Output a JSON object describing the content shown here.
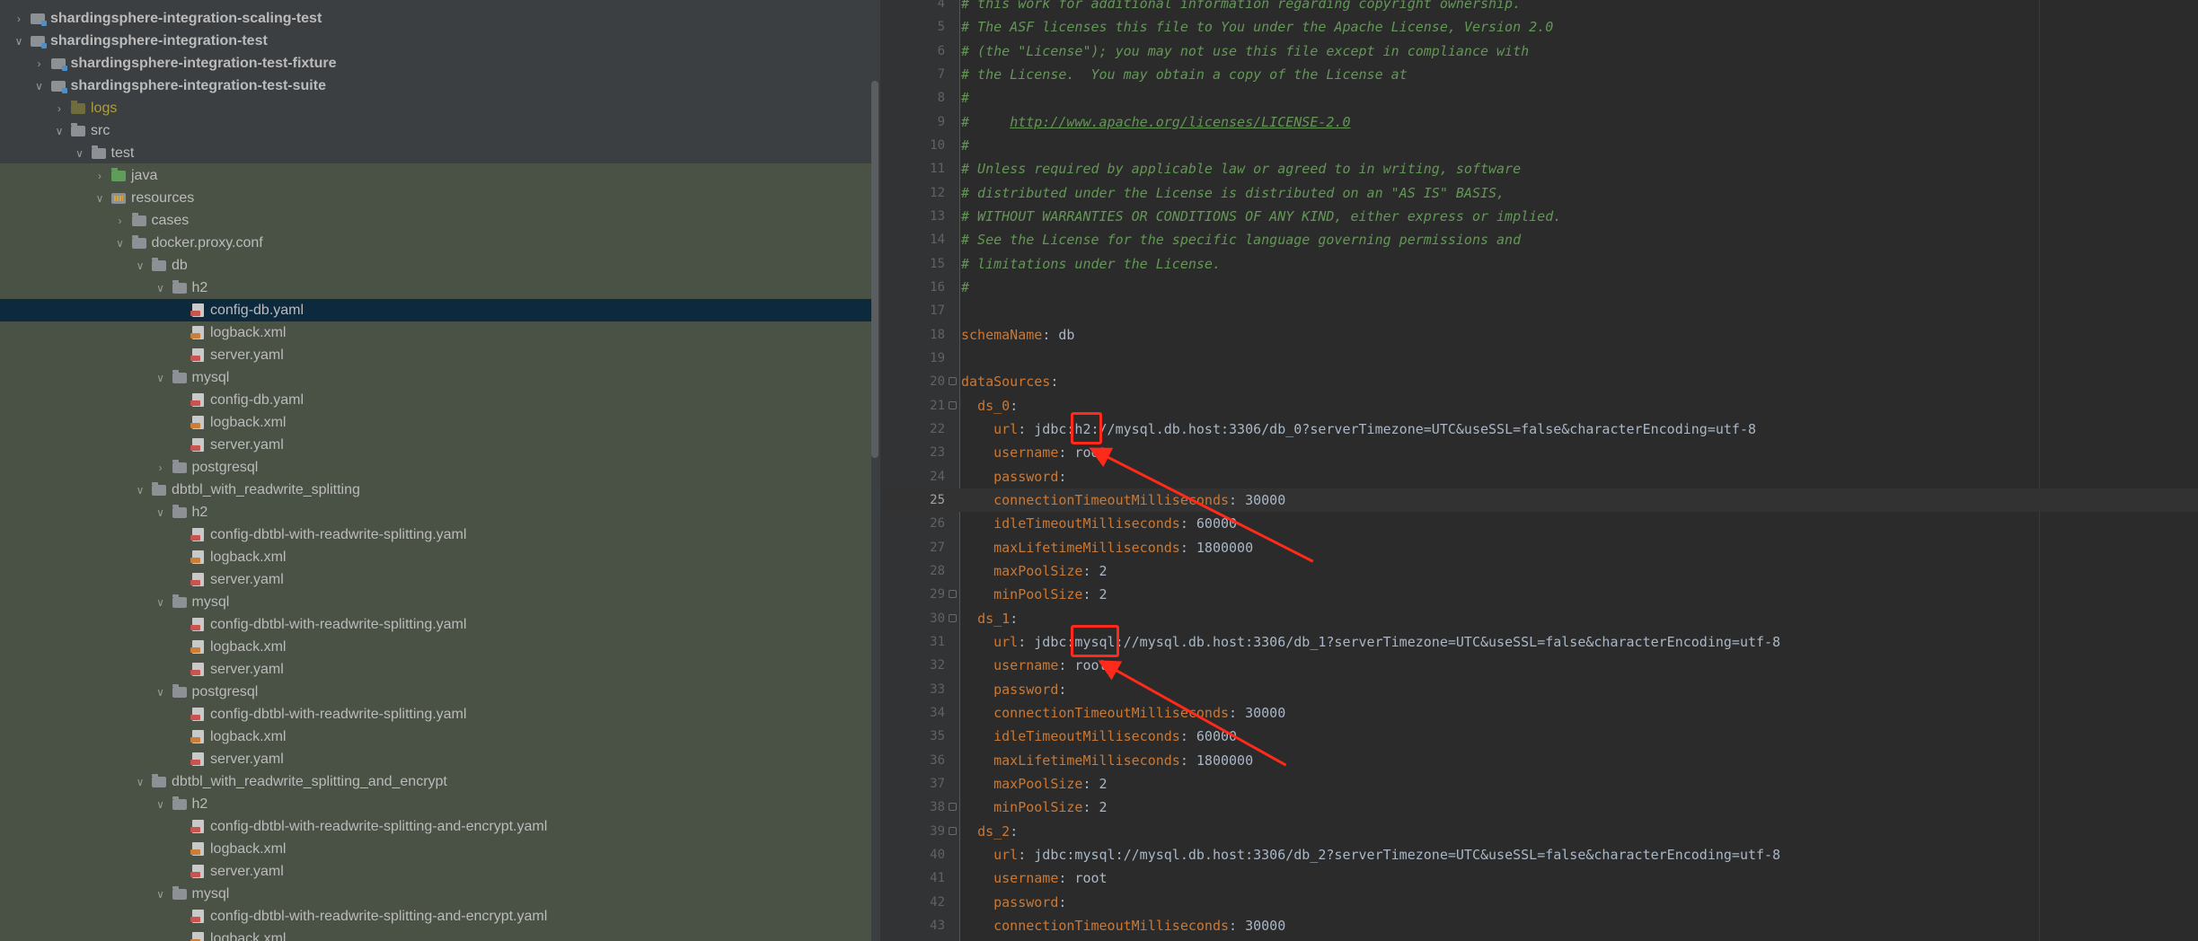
{
  "project_tree": {
    "rows": [
      {
        "label": "shardingsphere-integration-scaling-test",
        "depth": 1,
        "icon": "module",
        "expanded": false,
        "bold": true,
        "icon_name": "module-folder-icon"
      },
      {
        "label": "shardingsphere-integration-test",
        "depth": 1,
        "icon": "module",
        "expanded": true,
        "bold": true,
        "icon_name": "module-folder-icon"
      },
      {
        "label": "shardingsphere-integration-test-fixture",
        "depth": 2,
        "icon": "module",
        "expanded": false,
        "bold": true,
        "icon_name": "module-folder-icon"
      },
      {
        "label": "shardingsphere-integration-test-suite",
        "depth": 2,
        "icon": "module",
        "expanded": true,
        "bold": true,
        "icon_name": "module-folder-icon"
      },
      {
        "label": "logs",
        "depth": 3,
        "icon": "logs",
        "expanded": false,
        "excluded": true,
        "icon_name": "excluded-folder-icon"
      },
      {
        "label": "src",
        "depth": 3,
        "icon": "folder",
        "expanded": true,
        "icon_name": "folder-icon"
      },
      {
        "label": "test",
        "depth": 4,
        "icon": "folder",
        "expanded": true,
        "icon_name": "folder-icon"
      },
      {
        "label": "java",
        "depth": 5,
        "icon": "src",
        "expanded": false,
        "icon_name": "source-folder-icon"
      },
      {
        "label": "resources",
        "depth": 5,
        "icon": "res",
        "expanded": true,
        "icon_name": "resources-folder-icon"
      },
      {
        "label": "cases",
        "depth": 6,
        "icon": "folder",
        "expanded": false,
        "icon_name": "folder-icon"
      },
      {
        "label": "docker.proxy.conf",
        "depth": 6,
        "icon": "folder",
        "expanded": true,
        "icon_name": "folder-icon"
      },
      {
        "label": "db",
        "depth": 7,
        "icon": "folder",
        "expanded": true,
        "icon_name": "folder-icon"
      },
      {
        "label": "h2",
        "depth": 8,
        "icon": "folder",
        "expanded": true,
        "icon_name": "folder-icon"
      },
      {
        "label": "config-db.yaml",
        "depth": 9,
        "icon": "file",
        "selected": true,
        "icon_name": "yaml-file-icon"
      },
      {
        "label": "logback.xml",
        "depth": 9,
        "icon": "xml",
        "icon_name": "xml-file-icon"
      },
      {
        "label": "server.yaml",
        "depth": 9,
        "icon": "file",
        "icon_name": "yaml-file-icon"
      },
      {
        "label": "mysql",
        "depth": 8,
        "icon": "folder",
        "expanded": true,
        "icon_name": "folder-icon"
      },
      {
        "label": "config-db.yaml",
        "depth": 9,
        "icon": "file",
        "icon_name": "yaml-file-icon"
      },
      {
        "label": "logback.xml",
        "depth": 9,
        "icon": "xml",
        "icon_name": "xml-file-icon"
      },
      {
        "label": "server.yaml",
        "depth": 9,
        "icon": "file",
        "icon_name": "yaml-file-icon"
      },
      {
        "label": "postgresql",
        "depth": 8,
        "icon": "folder",
        "expanded": false,
        "icon_name": "folder-icon"
      },
      {
        "label": "dbtbl_with_readwrite_splitting",
        "depth": 7,
        "icon": "folder",
        "expanded": true,
        "icon_name": "folder-icon"
      },
      {
        "label": "h2",
        "depth": 8,
        "icon": "folder",
        "expanded": true,
        "icon_name": "folder-icon"
      },
      {
        "label": "config-dbtbl-with-readwrite-splitting.yaml",
        "depth": 9,
        "icon": "file",
        "icon_name": "yaml-file-icon"
      },
      {
        "label": "logback.xml",
        "depth": 9,
        "icon": "xml",
        "icon_name": "xml-file-icon"
      },
      {
        "label": "server.yaml",
        "depth": 9,
        "icon": "file",
        "icon_name": "yaml-file-icon"
      },
      {
        "label": "mysql",
        "depth": 8,
        "icon": "folder",
        "expanded": true,
        "icon_name": "folder-icon"
      },
      {
        "label": "config-dbtbl-with-readwrite-splitting.yaml",
        "depth": 9,
        "icon": "file",
        "icon_name": "yaml-file-icon"
      },
      {
        "label": "logback.xml",
        "depth": 9,
        "icon": "xml",
        "icon_name": "xml-file-icon"
      },
      {
        "label": "server.yaml",
        "depth": 9,
        "icon": "file",
        "icon_name": "yaml-file-icon"
      },
      {
        "label": "postgresql",
        "depth": 8,
        "icon": "folder",
        "expanded": true,
        "icon_name": "folder-icon"
      },
      {
        "label": "config-dbtbl-with-readwrite-splitting.yaml",
        "depth": 9,
        "icon": "file",
        "icon_name": "yaml-file-icon"
      },
      {
        "label": "logback.xml",
        "depth": 9,
        "icon": "xml",
        "icon_name": "xml-file-icon"
      },
      {
        "label": "server.yaml",
        "depth": 9,
        "icon": "file",
        "icon_name": "yaml-file-icon"
      },
      {
        "label": "dbtbl_with_readwrite_splitting_and_encrypt",
        "depth": 7,
        "icon": "folder",
        "expanded": true,
        "icon_name": "folder-icon"
      },
      {
        "label": "h2",
        "depth": 8,
        "icon": "folder",
        "expanded": true,
        "icon_name": "folder-icon"
      },
      {
        "label": "config-dbtbl-with-readwrite-splitting-and-encrypt.yaml",
        "depth": 9,
        "icon": "file",
        "icon_name": "yaml-file-icon"
      },
      {
        "label": "logback.xml",
        "depth": 9,
        "icon": "xml",
        "icon_name": "xml-file-icon"
      },
      {
        "label": "server.yaml",
        "depth": 9,
        "icon": "file",
        "icon_name": "yaml-file-icon"
      },
      {
        "label": "mysql",
        "depth": 8,
        "icon": "folder",
        "expanded": true,
        "icon_name": "folder-icon"
      },
      {
        "label": "config-dbtbl-with-readwrite-splitting-and-encrypt.yaml",
        "depth": 9,
        "icon": "file",
        "icon_name": "yaml-file-icon"
      },
      {
        "label": "logback.xml",
        "depth": 9,
        "icon": "xml",
        "icon_name": "xml-file-icon"
      }
    ]
  },
  "editor": {
    "current_line": 25,
    "lines": [
      {
        "n": 4,
        "spans": [
          {
            "t": "# this work for additional information regarding copyright ownership.",
            "c": "comment"
          }
        ]
      },
      {
        "n": 5,
        "spans": [
          {
            "t": "# The ASF licenses this file to You under the Apache License, Version 2.0",
            "c": "comment"
          }
        ]
      },
      {
        "n": 6,
        "spans": [
          {
            "t": "# (the \"License\"); you may not use this file except in compliance with",
            "c": "comment"
          }
        ]
      },
      {
        "n": 7,
        "spans": [
          {
            "t": "# the License.  You may obtain a copy of the License at",
            "c": "comment"
          }
        ]
      },
      {
        "n": 8,
        "spans": [
          {
            "t": "#",
            "c": "comment"
          }
        ]
      },
      {
        "n": 9,
        "spans": [
          {
            "t": "#     ",
            "c": "comment"
          },
          {
            "t": "http://www.apache.org/licenses/LICENSE-2.0",
            "c": "link"
          }
        ]
      },
      {
        "n": 10,
        "spans": [
          {
            "t": "#",
            "c": "comment"
          }
        ]
      },
      {
        "n": 11,
        "spans": [
          {
            "t": "# Unless required by applicable law or agreed to in writing, software",
            "c": "comment"
          }
        ]
      },
      {
        "n": 12,
        "spans": [
          {
            "t": "# distributed under the License is distributed on an \"AS IS\" BASIS,",
            "c": "comment"
          }
        ]
      },
      {
        "n": 13,
        "spans": [
          {
            "t": "# WITHOUT WARRANTIES OR CONDITIONS OF ANY KIND, either express or implied.",
            "c": "comment"
          }
        ]
      },
      {
        "n": 14,
        "spans": [
          {
            "t": "# See the License for the specific language governing permissions and",
            "c": "comment"
          }
        ]
      },
      {
        "n": 15,
        "spans": [
          {
            "t": "# limitations under the License.",
            "c": "comment"
          }
        ]
      },
      {
        "n": 16,
        "spans": [
          {
            "t": "#",
            "c": "comment"
          }
        ]
      },
      {
        "n": 17,
        "spans": []
      },
      {
        "n": 18,
        "spans": [
          {
            "t": "schemaName",
            "c": "key"
          },
          {
            "t": ": db",
            "c": "val"
          }
        ]
      },
      {
        "n": 19,
        "spans": []
      },
      {
        "n": 20,
        "fold": true,
        "spans": [
          {
            "t": "dataSources",
            "c": "key"
          },
          {
            "t": ":",
            "c": "val"
          }
        ]
      },
      {
        "n": 21,
        "fold": true,
        "spans": [
          {
            "t": "  ",
            "c": "val"
          },
          {
            "t": "ds_0",
            "c": "key"
          },
          {
            "t": ":",
            "c": "val"
          }
        ]
      },
      {
        "n": 22,
        "spans": [
          {
            "t": "    ",
            "c": "val"
          },
          {
            "t": "url",
            "c": "key"
          },
          {
            "t": ": jdbc:h2://mysql.db.host:3306/db_0?serverTimezone=UTC&useSSL=false&characterEncoding=utf-8",
            "c": "val"
          }
        ]
      },
      {
        "n": 23,
        "spans": [
          {
            "t": "    ",
            "c": "val"
          },
          {
            "t": "username",
            "c": "key"
          },
          {
            "t": ": root",
            "c": "val"
          }
        ]
      },
      {
        "n": 24,
        "spans": [
          {
            "t": "    ",
            "c": "val"
          },
          {
            "t": "password",
            "c": "key"
          },
          {
            "t": ":",
            "c": "val"
          }
        ]
      },
      {
        "n": 25,
        "spans": [
          {
            "t": "    ",
            "c": "val"
          },
          {
            "t": "connectionTimeoutMilliseconds",
            "c": "key"
          },
          {
            "t": ": 30000",
            "c": "val"
          }
        ]
      },
      {
        "n": 26,
        "spans": [
          {
            "t": "    ",
            "c": "val"
          },
          {
            "t": "idleTimeoutMilliseconds",
            "c": "key"
          },
          {
            "t": ": 60000",
            "c": "val"
          }
        ]
      },
      {
        "n": 27,
        "spans": [
          {
            "t": "    ",
            "c": "val"
          },
          {
            "t": "maxLifetimeMilliseconds",
            "c": "key"
          },
          {
            "t": ": 1800000",
            "c": "val"
          }
        ]
      },
      {
        "n": 28,
        "spans": [
          {
            "t": "    ",
            "c": "val"
          },
          {
            "t": "maxPoolSize",
            "c": "key"
          },
          {
            "t": ": 2",
            "c": "val"
          }
        ]
      },
      {
        "n": 29,
        "fold": true,
        "spans": [
          {
            "t": "    ",
            "c": "val"
          },
          {
            "t": "minPoolSize",
            "c": "key"
          },
          {
            "t": ": 2",
            "c": "val"
          }
        ]
      },
      {
        "n": 30,
        "fold": true,
        "spans": [
          {
            "t": "  ",
            "c": "val"
          },
          {
            "t": "ds_1",
            "c": "key"
          },
          {
            "t": ":",
            "c": "val"
          }
        ]
      },
      {
        "n": 31,
        "spans": [
          {
            "t": "    ",
            "c": "val"
          },
          {
            "t": "url",
            "c": "key"
          },
          {
            "t": ": jdbc:mysql://mysql.db.host:3306/db_1?serverTimezone=UTC&useSSL=false&characterEncoding=utf-8",
            "c": "val"
          }
        ]
      },
      {
        "n": 32,
        "spans": [
          {
            "t": "    ",
            "c": "val"
          },
          {
            "t": "username",
            "c": "key"
          },
          {
            "t": ": root",
            "c": "val"
          }
        ]
      },
      {
        "n": 33,
        "spans": [
          {
            "t": "    ",
            "c": "val"
          },
          {
            "t": "password",
            "c": "key"
          },
          {
            "t": ":",
            "c": "val"
          }
        ]
      },
      {
        "n": 34,
        "spans": [
          {
            "t": "    ",
            "c": "val"
          },
          {
            "t": "connectionTimeoutMilliseconds",
            "c": "key"
          },
          {
            "t": ": 30000",
            "c": "val"
          }
        ]
      },
      {
        "n": 35,
        "spans": [
          {
            "t": "    ",
            "c": "val"
          },
          {
            "t": "idleTimeoutMilliseconds",
            "c": "key"
          },
          {
            "t": ": 60000",
            "c": "val"
          }
        ]
      },
      {
        "n": 36,
        "spans": [
          {
            "t": "    ",
            "c": "val"
          },
          {
            "t": "maxLifetimeMilliseconds",
            "c": "key"
          },
          {
            "t": ": 1800000",
            "c": "val"
          }
        ]
      },
      {
        "n": 37,
        "spans": [
          {
            "t": "    ",
            "c": "val"
          },
          {
            "t": "maxPoolSize",
            "c": "key"
          },
          {
            "t": ": 2",
            "c": "val"
          }
        ]
      },
      {
        "n": 38,
        "fold": true,
        "spans": [
          {
            "t": "    ",
            "c": "val"
          },
          {
            "t": "minPoolSize",
            "c": "key"
          },
          {
            "t": ": 2",
            "c": "val"
          }
        ]
      },
      {
        "n": 39,
        "fold": true,
        "spans": [
          {
            "t": "  ",
            "c": "val"
          },
          {
            "t": "ds_2",
            "c": "key"
          },
          {
            "t": ":",
            "c": "val"
          }
        ]
      },
      {
        "n": 40,
        "spans": [
          {
            "t": "    ",
            "c": "val"
          },
          {
            "t": "url",
            "c": "key"
          },
          {
            "t": ": jdbc:mysql://mysql.db.host:3306/db_2?serverTimezone=UTC&useSSL=false&characterEncoding=utf-8",
            "c": "val"
          }
        ]
      },
      {
        "n": 41,
        "spans": [
          {
            "t": "    ",
            "c": "val"
          },
          {
            "t": "username",
            "c": "key"
          },
          {
            "t": ": root",
            "c": "val"
          }
        ]
      },
      {
        "n": 42,
        "spans": [
          {
            "t": "    ",
            "c": "val"
          },
          {
            "t": "password",
            "c": "key"
          },
          {
            "t": ":",
            "c": "val"
          }
        ]
      },
      {
        "n": 43,
        "spans": [
          {
            "t": "    ",
            "c": "val"
          },
          {
            "t": "connectionTimeoutMilliseconds",
            "c": "key"
          },
          {
            "t": ": 30000",
            "c": "val"
          }
        ]
      }
    ]
  },
  "annotations": {
    "color": "#ff2a1a",
    "highlights": [
      {
        "line": 22,
        "text": "h2:"
      },
      {
        "line": 31,
        "text": "mysql"
      }
    ]
  },
  "colors": {
    "tree_bg": "#3c3f41",
    "selection": "#0d293e",
    "comment": "#629755",
    "key": "#cc7832",
    "value": "#a9b7c6"
  }
}
